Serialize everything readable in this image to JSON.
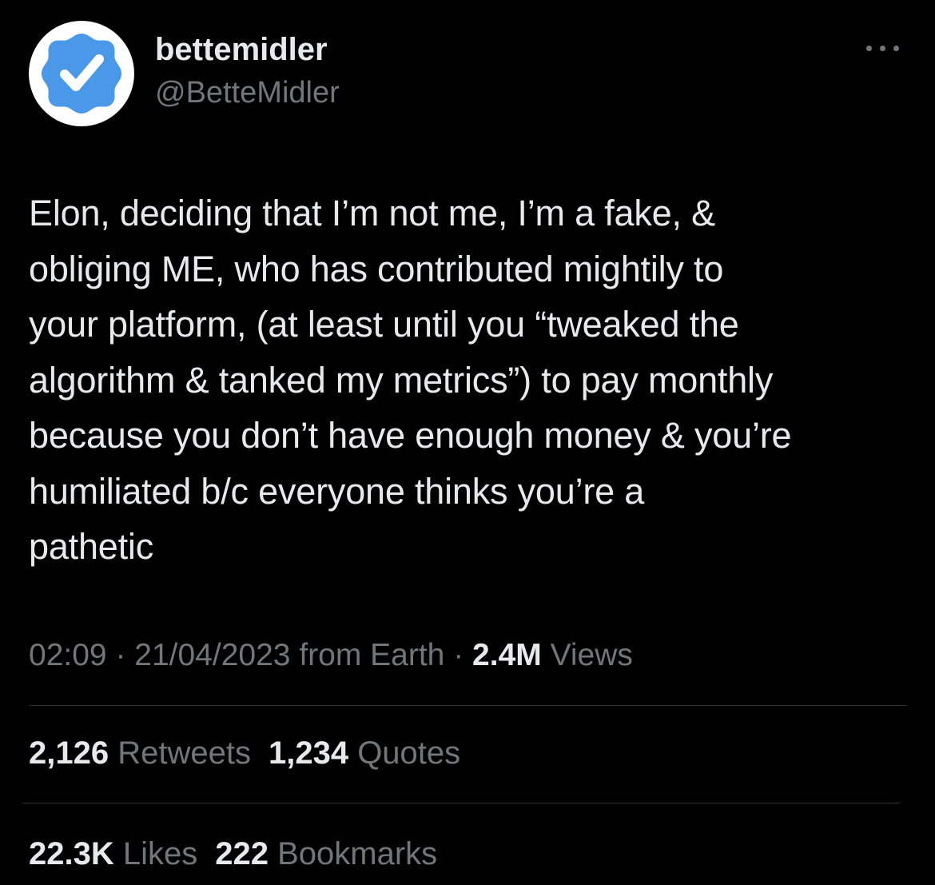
{
  "author": {
    "display_name": "bettemidler",
    "handle": "@BetteMidler",
    "avatar_icon": "verified-badge-icon",
    "avatar_colors": {
      "background": "#ffffff",
      "badge": "#4a99e9",
      "check": "#ffffff"
    }
  },
  "more_icon": "more-options-icon",
  "tweet": {
    "text": "Elon, deciding that I’m not me, I’m a fake, &\nobliging ME, who has contributed mightily to\nyour platform, (at least until you “tweaked the\nalgorithm & tanked my metrics”) to pay monthly\nbecause you don’t have enough money & you’re\nhumiliated b/c everyone thinks you’re a\npathetic"
  },
  "meta": {
    "time": "02:09",
    "separator": " · ",
    "date": "21/04/2023",
    "source": " from Earth",
    "views_count": "2.4M",
    "views_label": " Views"
  },
  "stats": {
    "retweets_count": "2,126",
    "retweets_label": " Retweets",
    "quotes_count": "1,234",
    "quotes_label": " Quotes",
    "likes_count": "22.3K",
    "likes_label": " Likes",
    "bookmarks_count": "222",
    "bookmarks_label": " Bookmarks"
  },
  "colors": {
    "background": "#000000",
    "primary_text": "#e7e9ea",
    "secondary_text": "#71767b",
    "divider": "#2f3336"
  }
}
